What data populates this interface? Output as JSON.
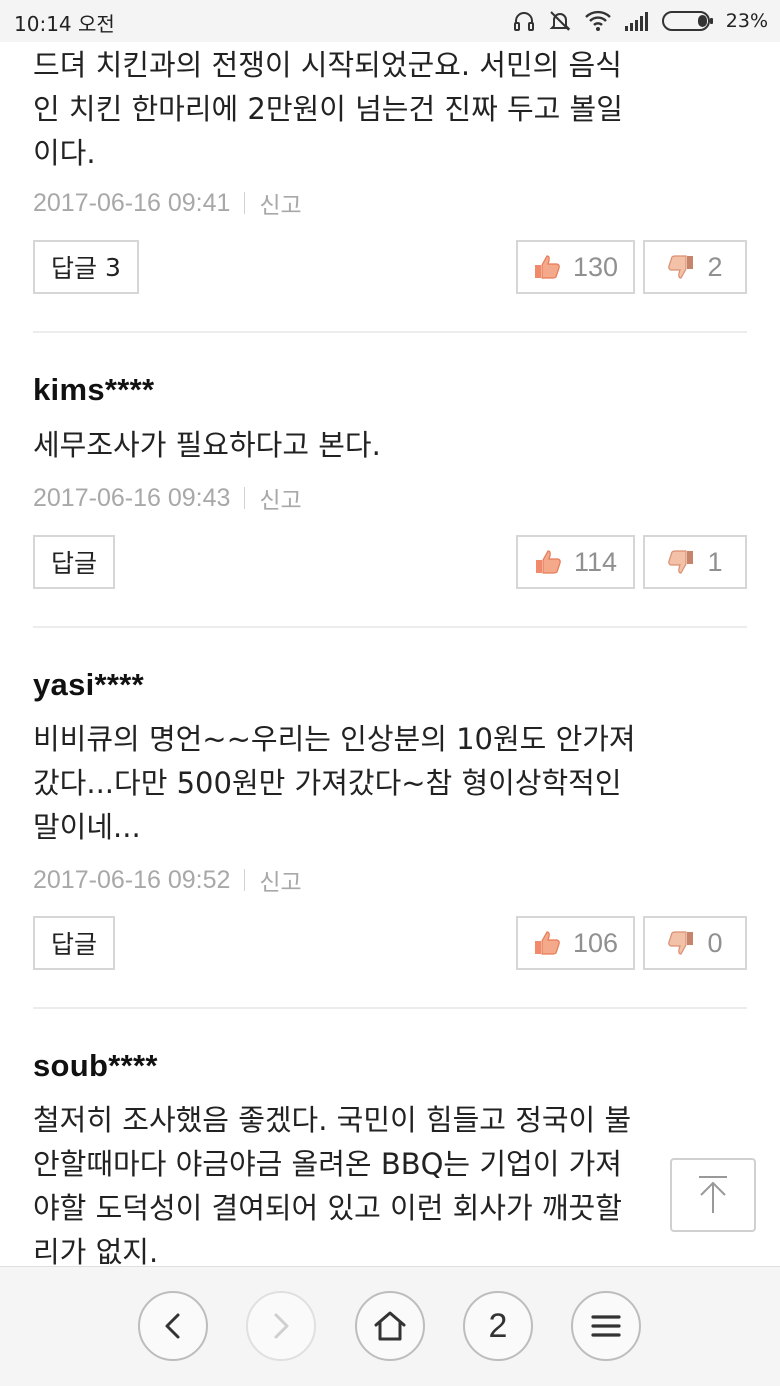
{
  "status_bar": {
    "time": "10:14 오전",
    "battery": "23%",
    "icons": [
      "headset-icon",
      "mute-icon",
      "wifi-icon",
      "signal-icon",
      "battery-icon"
    ]
  },
  "comments": [
    {
      "author": "",
      "text": "드뎌 치킨과의 전쟁이 시작되었군요. 서민의 음식\n인 치킨 한마리에 2만원이 넘는건 진짜 두고 볼일\n이다.",
      "date": "2017-06-16 09:41",
      "report_label": "신고",
      "reply_label": "답글",
      "reply_count": "3",
      "likes": "130",
      "dislikes": "2"
    },
    {
      "author": "kims****",
      "text": "세무조사가 필요하다고 본다.",
      "date": "2017-06-16 09:43",
      "report_label": "신고",
      "reply_label": "답글",
      "reply_count": "",
      "likes": "114",
      "dislikes": "1"
    },
    {
      "author": "yasi****",
      "text": "비비큐의 명언~~우리는 인상분의 10원도 안가져\n갔다...다만 500원만 가져갔다~참 형이상학적인\n말이네...",
      "date": "2017-06-16 09:52",
      "report_label": "신고",
      "reply_label": "답글",
      "reply_count": "",
      "likes": "106",
      "dislikes": "0"
    },
    {
      "author": "soub****",
      "text": "철저히 조사했음 좋겠다. 국민이 힘들고 정국이 불\n안할때마다 야금야금 올려온 BBQ는 기업이 가져\n야할 도덕성이 결여되어 있고 이런 회사가 깨끗할\n리가 없지."
    }
  ],
  "colors": {
    "like_icon": "#f08a6a",
    "dislike_icon": "#f3a98a",
    "border": "#d6d6d6",
    "meta_text": "#a8a8a8"
  },
  "bottom_bar": {
    "tab_count": "2",
    "buttons": [
      "back-icon",
      "forward-icon",
      "home-icon",
      "tabs-button",
      "menu-icon"
    ]
  }
}
